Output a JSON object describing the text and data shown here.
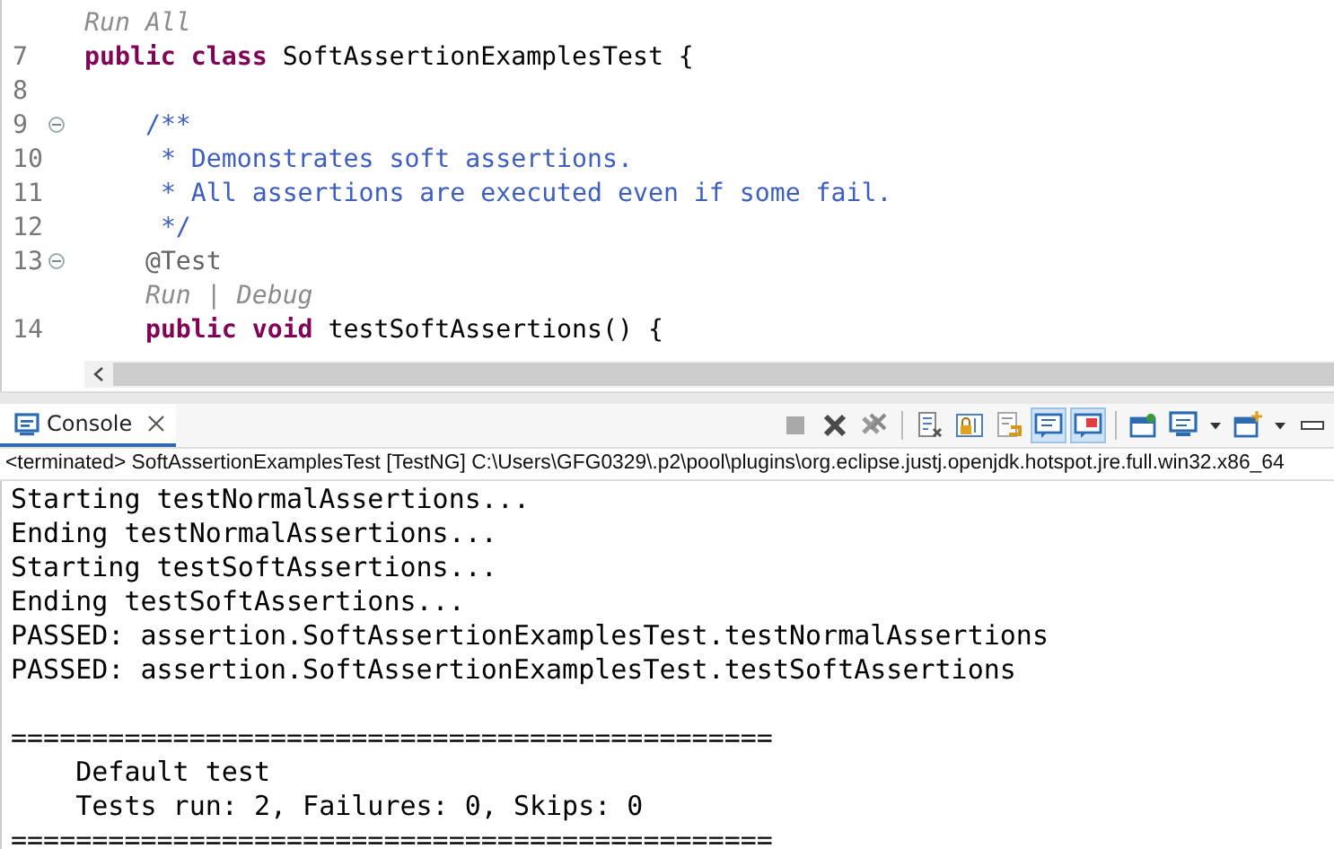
{
  "editor": {
    "lines": [
      {
        "segments": [
          {
            "kind": "hint",
            "text": "Run All"
          }
        ]
      },
      {
        "number": "7",
        "segments": [
          {
            "kind": "keyword",
            "text": "public class "
          },
          {
            "kind": "plain",
            "text": "SoftAssertionExamplesTest {"
          }
        ]
      },
      {
        "number": "8"
      },
      {
        "number": "9",
        "fold": true,
        "segments": [
          {
            "kind": "comment",
            "text": "    /**"
          }
        ]
      },
      {
        "number": "10",
        "segments": [
          {
            "kind": "comment",
            "text": "     * Demonstrates soft assertions."
          }
        ]
      },
      {
        "number": "11",
        "segments": [
          {
            "kind": "comment",
            "text": "     * All assertions are executed even if some fail."
          }
        ]
      },
      {
        "number": "12",
        "segments": [
          {
            "kind": "comment",
            "text": "     */"
          }
        ]
      },
      {
        "number": "13",
        "fold": true,
        "segments": [
          {
            "kind": "annotation",
            "text": "    @Test"
          }
        ]
      },
      {
        "segments": [
          {
            "kind": "hint",
            "text": "    Run | Debug"
          }
        ]
      },
      {
        "number": "14",
        "segments": [
          {
            "kind": "keyword",
            "text": "    public void "
          },
          {
            "kind": "plain",
            "text": "testSoftAssertions() {"
          }
        ]
      }
    ]
  },
  "console": {
    "tab": {
      "label": "Console",
      "selected": true
    },
    "toolbar": [
      {
        "kind": "stop"
      },
      {
        "kind": "remove"
      },
      {
        "kind": "remove-all"
      },
      {
        "kind": "sep"
      },
      {
        "kind": "clear"
      },
      {
        "kind": "lock"
      },
      {
        "kind": "wrap"
      },
      {
        "kind": "show-out",
        "on": true
      },
      {
        "kind": "show-err",
        "on": true
      },
      {
        "kind": "sep"
      },
      {
        "kind": "pin"
      },
      {
        "kind": "display"
      },
      {
        "kind": "caret"
      },
      {
        "kind": "new"
      },
      {
        "kind": "caret"
      },
      {
        "kind": "minimize"
      }
    ],
    "header": "<terminated> SoftAssertionExamplesTest [TestNG] C:\\Users\\GFG0329\\.p2\\pool\\plugins\\org.eclipse.justj.openjdk.hotspot.jre.full.win32.x86_64",
    "output": [
      {
        "kind": "line",
        "text": "Starting testNormalAssertions..."
      },
      {
        "kind": "line",
        "text": "Ending testNormalAssertions..."
      },
      {
        "kind": "line",
        "text": "Starting testSoftAssertions..."
      },
      {
        "kind": "line",
        "text": "Ending testSoftAssertions..."
      },
      {
        "kind": "line",
        "text": "PASSED: assertion.SoftAssertionExamplesTest.testNormalAssertions"
      },
      {
        "kind": "line",
        "text": "PASSED: assertion.SoftAssertionExamplesTest.testSoftAssertions"
      },
      {
        "kind": "blank"
      },
      {
        "kind": "rule",
        "text": "==============================================="
      },
      {
        "kind": "line",
        "text": "    Default test"
      },
      {
        "kind": "line",
        "text": "    Tests run: 2, Failures: 0, Skips: 0"
      },
      {
        "kind": "rule",
        "text": "==============================================="
      }
    ]
  }
}
